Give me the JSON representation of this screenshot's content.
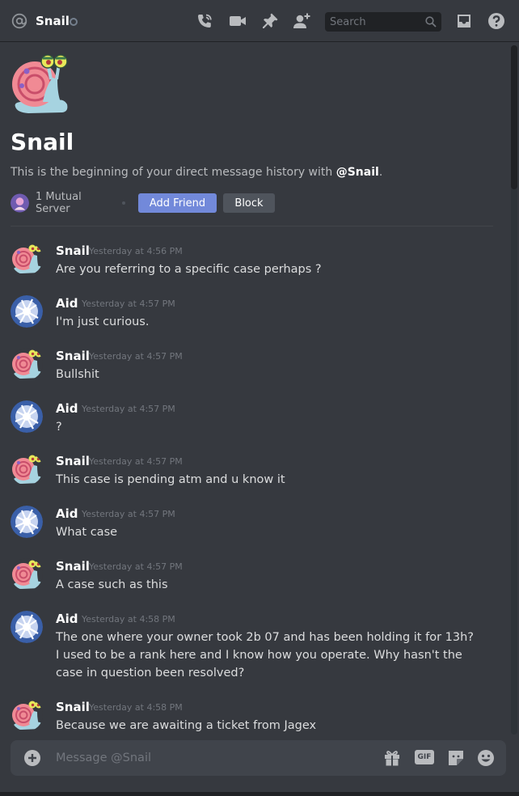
{
  "topbar": {
    "title": "Snail",
    "search_placeholder": "Search"
  },
  "icons": {
    "at": "at-icon",
    "call": "phone-call-icon",
    "video": "video-camera-icon",
    "pin": "pin-icon",
    "add_friend": "add-friend-icon",
    "search": "search-icon",
    "inbox": "inbox-icon",
    "help": "help-icon",
    "add_attachment": "plus-circle-icon",
    "gift": "gift-icon",
    "gif": "gif-icon",
    "sticker": "sticker-icon",
    "emoji": "emoji-icon"
  },
  "hero": {
    "name": "Snail",
    "desc_prefix": "This is the beginning of your direct message history with ",
    "desc_handle": "@Snail",
    "desc_suffix": ".",
    "mutual_servers": "1 Mutual Server",
    "add_friend_label": "Add Friend",
    "block_label": "Block"
  },
  "messages": [
    {
      "author": "Snail",
      "time": "Yesterday at 4:56 PM",
      "text": "Are you referring to a specific case perhaps ?"
    },
    {
      "author": "Aid",
      "time": "Yesterday at 4:57 PM",
      "text": "I'm just curious."
    },
    {
      "author": "Snail",
      "time": "Yesterday at 4:57 PM",
      "text": "Bullshit"
    },
    {
      "author": "Aid",
      "time": "Yesterday at 4:57 PM",
      "text": "?"
    },
    {
      "author": "Snail",
      "time": "Yesterday at 4:57 PM",
      "text": "This case is pending atm and u know it"
    },
    {
      "author": "Aid",
      "time": "Yesterday at 4:57 PM",
      "text": "What case"
    },
    {
      "author": "Snail",
      "time": "Yesterday at 4:57 PM",
      "text": "A case such as this"
    },
    {
      "author": "Aid",
      "time": "Yesterday at 4:58 PM",
      "text": "The one where your owner took 2b 07 and has been holding it for 13h? I used to be a rank here and I know how you operate. Why hasn't the case in question been resolved?"
    },
    {
      "author": "Snail",
      "time": "Yesterday at 4:58 PM",
      "text": "Because we are awaiting a ticket from Jagex"
    }
  ],
  "composer": {
    "placeholder": "Message @Snail",
    "gif_label": "GIF"
  },
  "colors": {
    "background": "#36393f",
    "accent": "#7289da",
    "block_button": "#4f545c",
    "composer": "#40444b"
  }
}
